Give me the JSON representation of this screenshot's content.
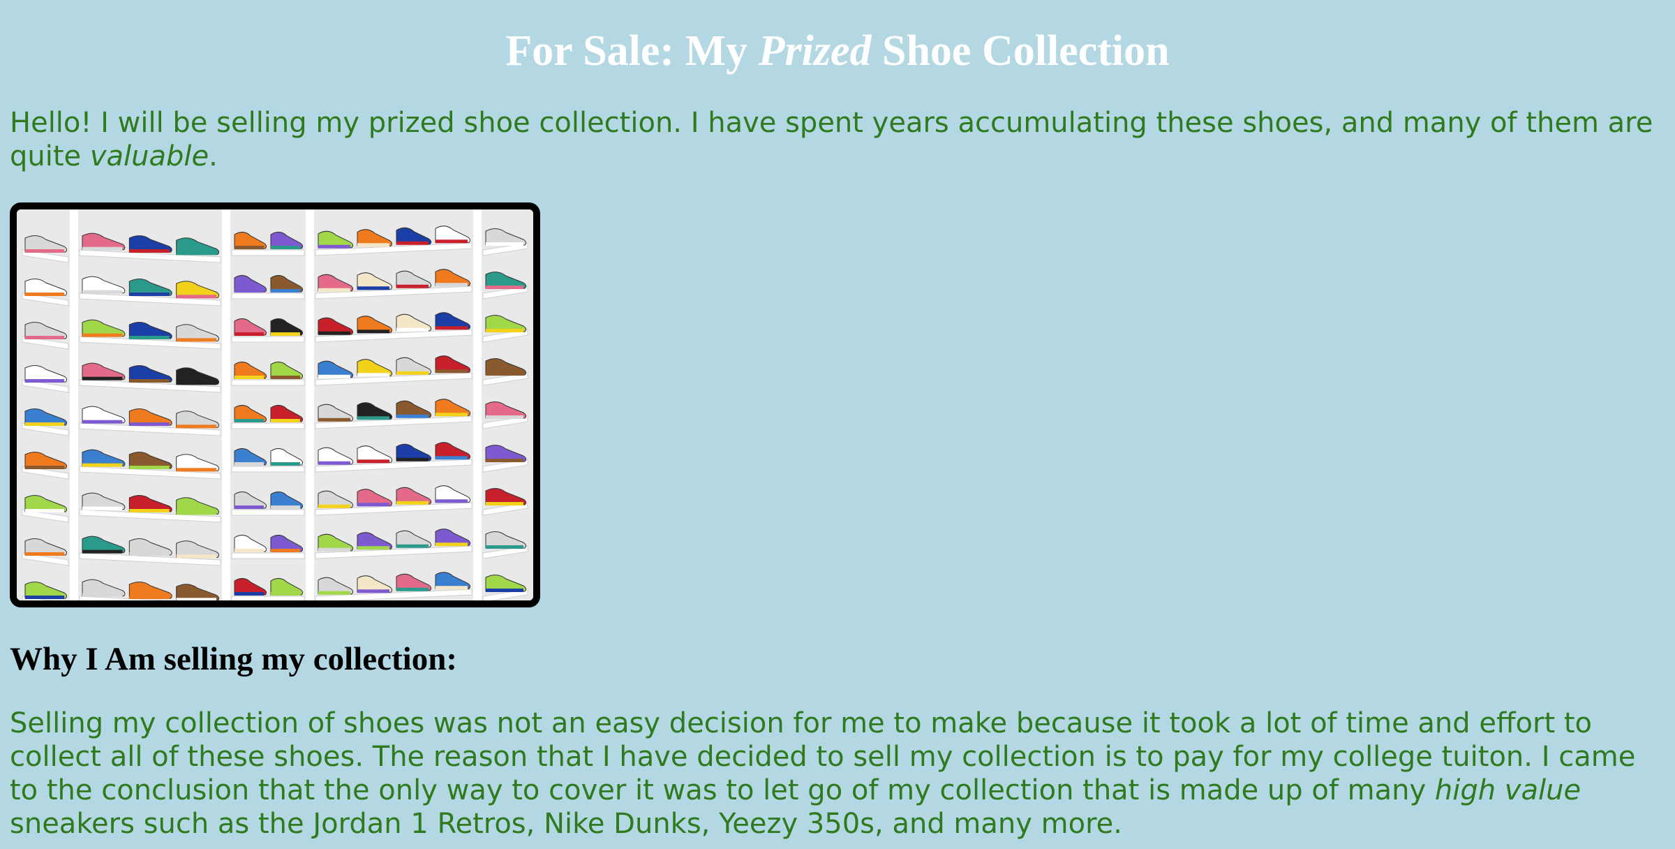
{
  "header": {
    "title_prefix": "For Sale: My ",
    "title_emphasis": "Prized",
    "title_suffix": " Shoe Collection"
  },
  "intro": {
    "text": "Hello! I will be selling my prized shoe collection. I have spent years accumulating these shoes, and many of them are quite ",
    "emphasis": "valuable",
    "suffix": "."
  },
  "photo": {
    "icon": "shoe-collection-photo",
    "colors": {
      "frame": "#000000",
      "shelf": "#ffffff",
      "wall": "#e9e9ea"
    }
  },
  "section": {
    "heading": "Why I Am selling my collection:"
  },
  "body": {
    "text": "Selling my collection of shoes was not an easy decision for me to make because it took a lot of time and effort to collect all of these shoes. The reason that I have decided to sell my collection is to pay for my college tuiton. I came to the conclusion that the only way to cover it was to let go of my collection that is made up of many ",
    "emphasis": "high value",
    "suffix": " sneakers such as the Jordan 1 Retros, Nike Dunks, Yeezy 350s, and many more."
  },
  "theme": {
    "background": "#b4d8e3",
    "title_color": "#ffffff",
    "text_color": "#2f7a1f",
    "heading_color": "#000000"
  }
}
